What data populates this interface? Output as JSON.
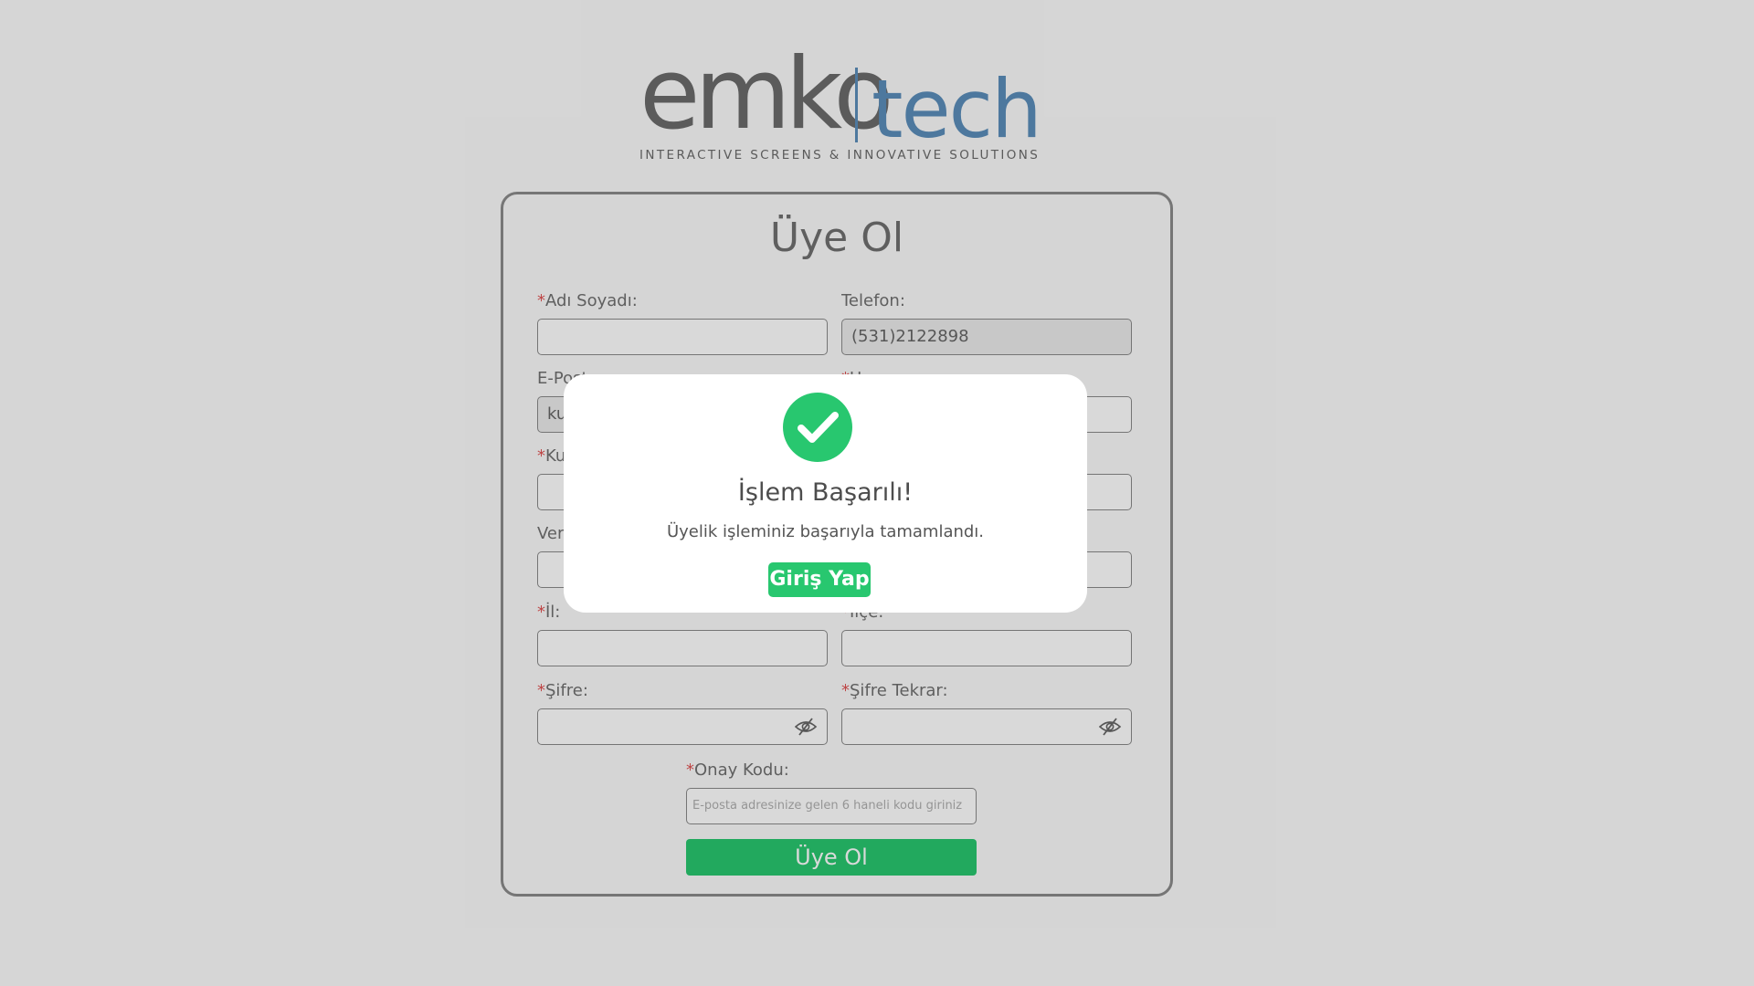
{
  "brand": {
    "logo_primary": "emko",
    "logo_secondary": "tech",
    "tagline": "INTERACTIVE SCREENS & INNOVATIVE SOLUTIONS",
    "primary_color": "#6b6b6b",
    "secondary_color": "#5b8eba"
  },
  "form": {
    "title": "Üye Ol",
    "required_mark": "*",
    "fields": {
      "name": {
        "label": "Adı Soyadı:",
        "value": ""
      },
      "phone": {
        "label": "Telefon:",
        "value": "(531)2122898"
      },
      "email": {
        "label": "E-Posta:",
        "value": "ku"
      },
      "unvan": {
        "label": "Unvan:",
        "value": ""
      },
      "kurum": {
        "label": "Ku",
        "value": ""
      },
      "right3": {
        "label": "",
        "value": ""
      },
      "vergi": {
        "label": "Ver",
        "value": ""
      },
      "right4": {
        "label": "",
        "value": ""
      },
      "il": {
        "label": "İl:",
        "value": ""
      },
      "ilce": {
        "label": "İlçe:",
        "value": ""
      },
      "sifre": {
        "label": "Şifre:",
        "value": ""
      },
      "sifre_tekrar": {
        "label": "Şifre Tekrar:",
        "value": ""
      },
      "onay_kodu": {
        "label": "Onay Kodu:",
        "placeholder": "E-posta adresinize gelen 6 haneli kodu giriniz"
      }
    },
    "submit_label": "Üye Ol",
    "accent_color": "#28c76f"
  },
  "modal": {
    "icon": "check-circle-icon",
    "title": "İşlem Başarılı!",
    "message": "Üyelik işleminiz başarıyla tamamlandı.",
    "button_label": "Giriş Yap"
  }
}
